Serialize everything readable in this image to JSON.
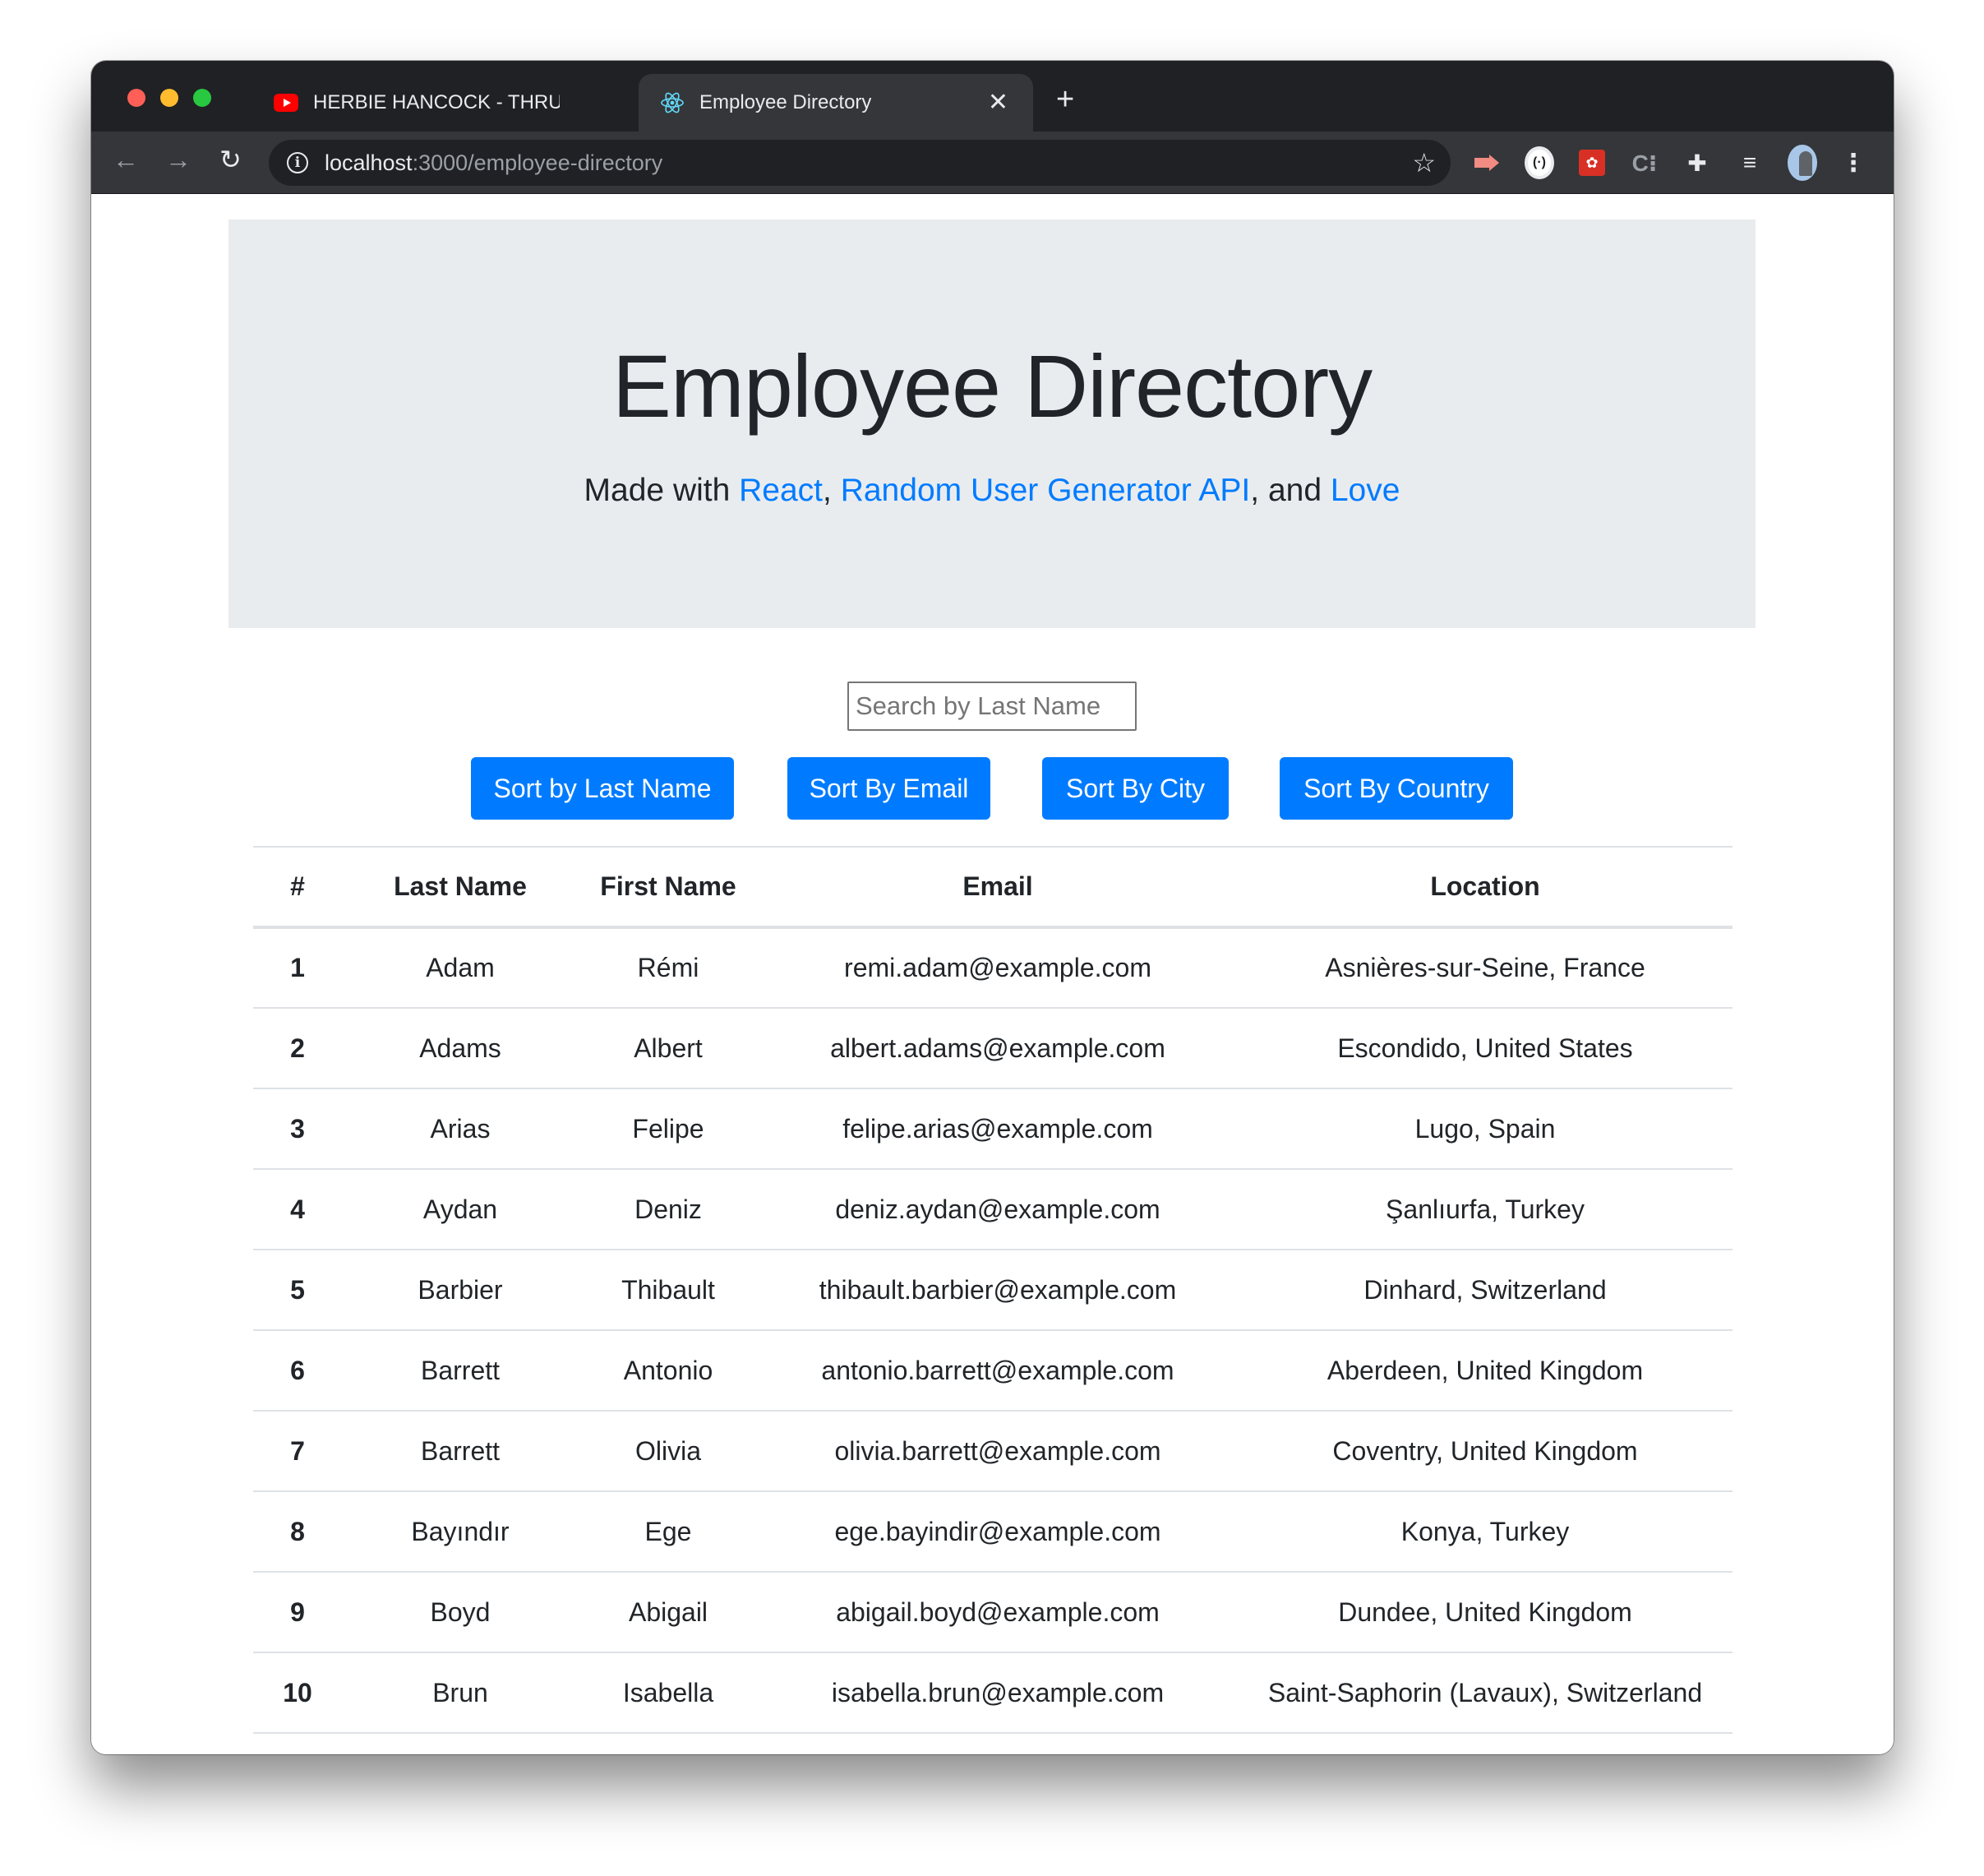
{
  "browser": {
    "tabs": [
      {
        "title": "HERBIE HANCOCK - THRU",
        "favicon": "youtube-icon",
        "audio": true,
        "active": false
      },
      {
        "title": "Employee Directory",
        "favicon": "react-icon",
        "audio": false,
        "active": true
      }
    ],
    "address": {
      "host": "localhost",
      "path": ":3000/employee-directory"
    },
    "colors": {
      "tabstrip": "#202124",
      "toolbar": "#35363a"
    }
  },
  "hero": {
    "title": "Employee Directory",
    "made_with": "Made with ",
    "link_react": "React",
    "sep1": ", ",
    "link_api": "Random User Generator API",
    "sep2": ", and ",
    "link_love": "Love"
  },
  "search": {
    "placeholder": "Search by Last Name",
    "value": ""
  },
  "sort_buttons": {
    "last_name": "Sort by Last Name",
    "email": "Sort By Email",
    "city": "Sort By City",
    "country": "Sort By Country"
  },
  "table": {
    "headers": {
      "num": "#",
      "last": "Last Name",
      "first": "First Name",
      "email": "Email",
      "location": "Location"
    },
    "rows": [
      {
        "num": "1",
        "last": "Adam",
        "first": "Rémi",
        "email": "remi.adam@example.com",
        "location": "Asnières-sur-Seine, France"
      },
      {
        "num": "2",
        "last": "Adams",
        "first": "Albert",
        "email": "albert.adams@example.com",
        "location": "Escondido, United States"
      },
      {
        "num": "3",
        "last": "Arias",
        "first": "Felipe",
        "email": "felipe.arias@example.com",
        "location": "Lugo, Spain"
      },
      {
        "num": "4",
        "last": "Aydan",
        "first": "Deniz",
        "email": "deniz.aydan@example.com",
        "location": "Şanlıurfa, Turkey"
      },
      {
        "num": "5",
        "last": "Barbier",
        "first": "Thibault",
        "email": "thibault.barbier@example.com",
        "location": "Dinhard, Switzerland"
      },
      {
        "num": "6",
        "last": "Barrett",
        "first": "Antonio",
        "email": "antonio.barrett@example.com",
        "location": "Aberdeen, United Kingdom"
      },
      {
        "num": "7",
        "last": "Barrett",
        "first": "Olivia",
        "email": "olivia.barrett@example.com",
        "location": "Coventry, United Kingdom"
      },
      {
        "num": "8",
        "last": "Bayındır",
        "first": "Ege",
        "email": "ege.bayindir@example.com",
        "location": "Konya, Turkey"
      },
      {
        "num": "9",
        "last": "Boyd",
        "first": "Abigail",
        "email": "abigail.boyd@example.com",
        "location": "Dundee, United Kingdom"
      },
      {
        "num": "10",
        "last": "Brun",
        "first": "Isabella",
        "email": "isabella.brun@example.com",
        "location": "Saint-Saphorin (Lavaux), Switzerland"
      }
    ]
  },
  "theme": {
    "primary": "#007bff",
    "jumbotron_bg": "#e9ecef",
    "text": "#212529"
  }
}
